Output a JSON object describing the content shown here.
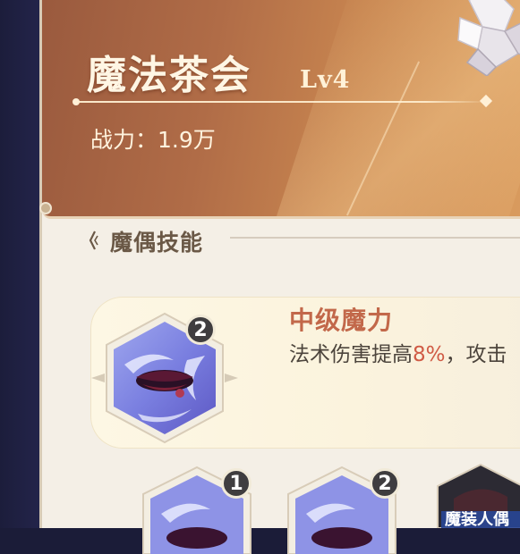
{
  "header": {
    "doll_name": "魔法茶会",
    "level": "Lv4",
    "power_label": "战力：",
    "power_value": "1.9万"
  },
  "section": {
    "title": "魔偶技能"
  },
  "featured_skill": {
    "name": "中级魔力",
    "desc_prefix": "法术伤害提高",
    "desc_highlight": "8%",
    "desc_suffix": "，攻击",
    "badge": "2"
  },
  "skill_row": [
    {
      "badge": "1"
    },
    {
      "badge": "2"
    },
    {
      "partial_label": "魔装人偶"
    }
  ],
  "colors": {
    "banner": "#b06c47",
    "skill_name": "#c2684a",
    "highlight": "#d05b45",
    "panel": "#f4efe6"
  }
}
